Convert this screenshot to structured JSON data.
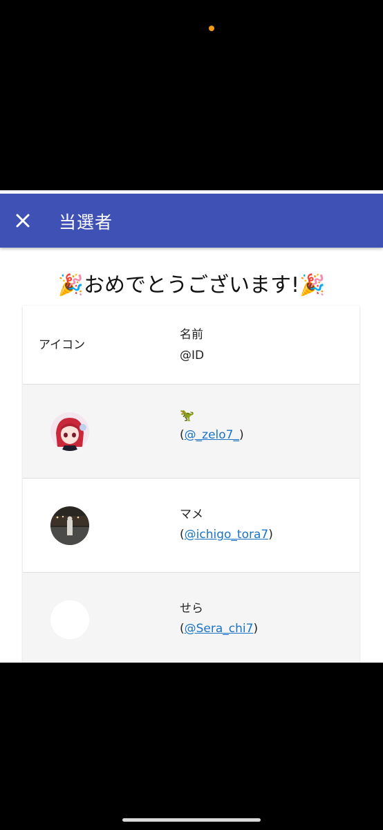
{
  "appbar": {
    "title": "当選者",
    "color": "#3f51b5"
  },
  "banner": {
    "text": "🎉おめでとうございます!🎉"
  },
  "table": {
    "headers": {
      "icon": "アイコン",
      "name": "名前",
      "id": "@ID"
    },
    "rows": [
      {
        "avatar": "anime-avatar-icon",
        "name": "🦖",
        "open_paren": "(",
        "handle": "@_zelo7_",
        "close_paren": ")"
      },
      {
        "avatar": "photo-avatar-icon",
        "name": "マメ",
        "open_paren": "(",
        "handle": "@ichigo_tora7",
        "close_paren": ")"
      },
      {
        "avatar": "blank-avatar-icon",
        "name": "せら",
        "open_paren": "(",
        "handle": "@Sera_chi7",
        "close_paren": ")"
      }
    ]
  },
  "colors": {
    "link": "#1a73c8",
    "row_alt": "#f5f5f5"
  }
}
